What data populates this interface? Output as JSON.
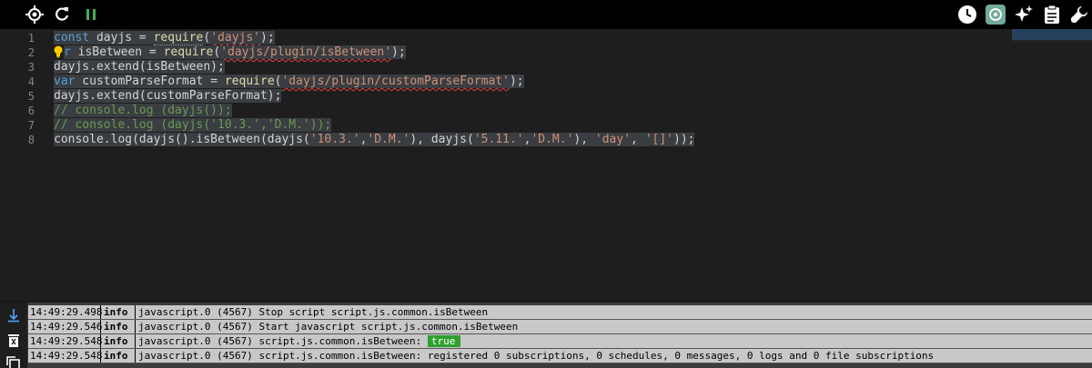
{
  "toolbar": {
    "left_icons": [
      "crosshair-icon",
      "refresh-icon",
      "pause-icon"
    ],
    "right_icons": [
      "clock-icon",
      "chatgpt-icon",
      "sparkle-icon",
      "clipboard-icon",
      "wrench-icon"
    ],
    "colors": {
      "pause": "#4caf50",
      "chatgpt_bg": "#74aa9c"
    }
  },
  "editor": {
    "line_numbers": [
      "1",
      "2",
      "3",
      "4",
      "5",
      "6",
      "7",
      "8"
    ],
    "lines": [
      [
        {
          "t": "const",
          "c": "kw"
        },
        {
          "t": " dayjs = ",
          "c": "ident"
        },
        {
          "t": "require",
          "c": "fn"
        },
        {
          "t": "(",
          "c": "ident"
        },
        {
          "t": "'dayjs'",
          "c": "str"
        },
        {
          "t": ");",
          "c": "ident"
        }
      ],
      [
        {
          "t": "r",
          "c": "kw"
        },
        {
          "t": " isBetween = ",
          "c": "ident"
        },
        {
          "t": "require",
          "c": "fn"
        },
        {
          "t": "(",
          "c": "ident"
        },
        {
          "t": "'dayjs/plugin/isBetween'",
          "c": "str"
        },
        {
          "t": ");",
          "c": "ident"
        }
      ],
      [
        {
          "t": "dayjs.extend(isBetween);",
          "c": "ident"
        }
      ],
      [
        {
          "t": "var",
          "c": "kw"
        },
        {
          "t": " customParseFormat = ",
          "c": "ident"
        },
        {
          "t": "require",
          "c": "fn"
        },
        {
          "t": "(",
          "c": "ident"
        },
        {
          "t": "'dayjs/plugin/customParseFormat'",
          "c": "str"
        },
        {
          "t": ");",
          "c": "ident"
        }
      ],
      [
        {
          "t": "dayjs.extend(customParseFormat);",
          "c": "ident"
        }
      ],
      [
        {
          "t": "// console.log (dayjs());",
          "c": "cm"
        }
      ],
      [
        {
          "t": "// console.log (dayjs('10.3.','D.M.'));",
          "c": "cm"
        }
      ],
      [
        {
          "t": "console.log(dayjs().isBetween(dayjs(",
          "c": "ident"
        },
        {
          "t": "'10.3.'",
          "c": "str"
        },
        {
          "t": ",",
          "c": "ident"
        },
        {
          "t": "'D.M.'",
          "c": "str"
        },
        {
          "t": "), dayjs(",
          "c": "ident"
        },
        {
          "t": "'5.11.'",
          "c": "str"
        },
        {
          "t": ",",
          "c": "ident"
        },
        {
          "t": "'D.M.'",
          "c": "str"
        },
        {
          "t": "), ",
          "c": "ident"
        },
        {
          "t": "'day'",
          "c": "str"
        },
        {
          "t": ", ",
          "c": "ident"
        },
        {
          "t": "'[]'",
          "c": "str"
        },
        {
          "t": "));",
          "c": "ident"
        }
      ]
    ]
  },
  "log": {
    "tool_icons": [
      "scroll-down-icon",
      "delete-icon",
      "copy-icon"
    ],
    "rows": [
      {
        "time": "14:49:29.498",
        "level": "info",
        "msg": "javascript.0 (4567) Stop script script.js.common.isBetween",
        "hl": ""
      },
      {
        "time": "14:49:29.546",
        "level": "info",
        "msg": "javascript.0 (4567) Start javascript script.js.common.isBetween",
        "hl": ""
      },
      {
        "time": "14:49:29.548",
        "level": "info",
        "msg": "javascript.0 (4567) script.js.common.isBetween: ",
        "hl": "true"
      },
      {
        "time": "14:49:29.548",
        "level": "info",
        "msg": "javascript.0 (4567) script.js.common.isBetween: registered 0 subscriptions, 0 schedules, 0 messages, 0 logs and 0 file subscriptions",
        "hl": ""
      }
    ]
  }
}
